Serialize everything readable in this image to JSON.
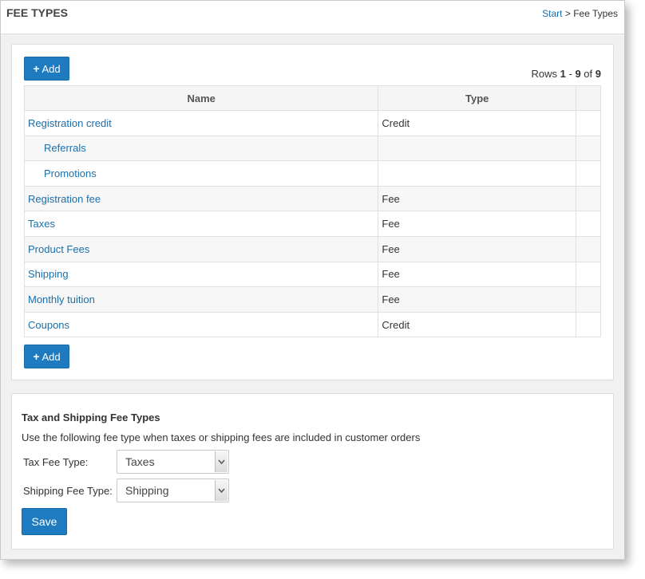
{
  "header": {
    "title": "FEE TYPES",
    "breadcrumb": {
      "start": "Start",
      "separator": ">",
      "current": "Fee Types"
    }
  },
  "table": {
    "add_label": "Add",
    "rows_info": {
      "prefix": "Rows",
      "from": "1",
      "dash": "-",
      "to": "9",
      "of": "of",
      "total": "9"
    },
    "columns": {
      "name": "Name",
      "type": "Type"
    },
    "rows": [
      {
        "name": "Registration credit",
        "type": "Credit"
      },
      {
        "name": "Referrals",
        "type": ""
      },
      {
        "name": "Promotions",
        "type": ""
      },
      {
        "name": "Registration fee",
        "type": "Fee"
      },
      {
        "name": "Taxes",
        "type": "Fee"
      },
      {
        "name": "Product Fees",
        "type": "Fee"
      },
      {
        "name": "Shipping",
        "type": "Fee"
      },
      {
        "name": "Monthly tuition",
        "type": "Fee"
      },
      {
        "name": "Coupons",
        "type": "Credit"
      }
    ]
  },
  "tax_section": {
    "heading": "Tax and Shipping Fee Types",
    "description": "Use the following fee type when taxes or shipping fees are included in customer orders",
    "tax_label": "Tax Fee Type:",
    "tax_value": "Taxes",
    "shipping_label": "Shipping Fee Type:",
    "shipping_value": "Shipping",
    "save_label": "Save"
  },
  "colors": {
    "accent": "#1f7bbf",
    "link": "#1a6fab"
  }
}
